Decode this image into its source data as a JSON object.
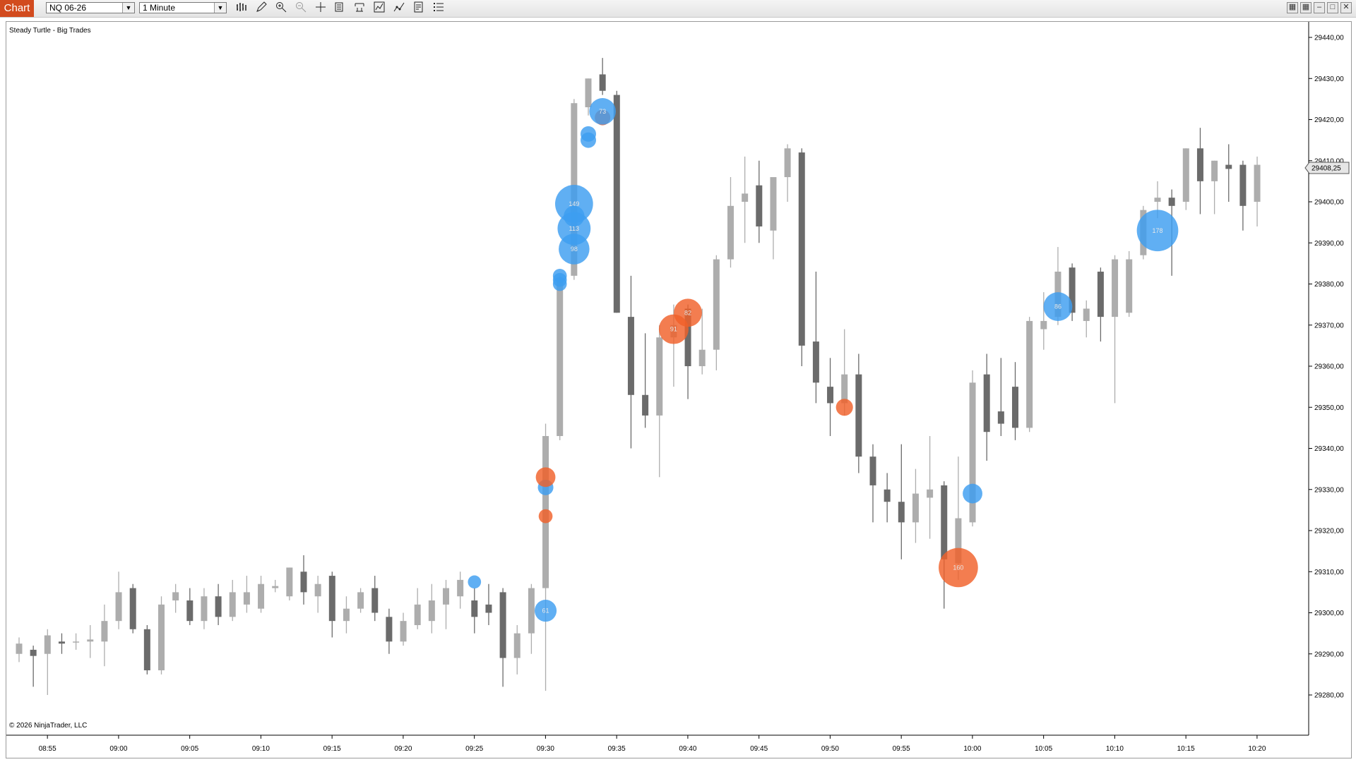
{
  "toolbar": {
    "tab_label": "Chart",
    "instrument": "NQ 06-26",
    "interval": "1 Minute",
    "icons": [
      "bar-type-icon",
      "pencil-icon",
      "zoom-in-icon",
      "zoom-out-icon",
      "crosshair-icon",
      "data-box-icon",
      "properties-icon",
      "strategies-icon",
      "indicators-icon",
      "templates-icon",
      "list-icon"
    ],
    "window_buttons": [
      "tile-icon",
      "snap-icon",
      "minimize-icon",
      "maximize-icon",
      "close-icon"
    ]
  },
  "chart": {
    "indicator_label": "Steady Turtle - Big Trades",
    "copyright": "© 2026 NinjaTrader, LLC",
    "current_price_label": "29408,25",
    "colors": {
      "up": "#adadad",
      "down": "#6b6b6b",
      "buy": "#3d9df0",
      "sell": "#f0602a",
      "price_tag_bg": "#e6e6e6"
    }
  },
  "chart_data": {
    "type": "candlestick",
    "x_tick_labels": [
      "08:55",
      "09:00",
      "09:05",
      "09:10",
      "09:15",
      "09:20",
      "09:25",
      "09:30",
      "09:35",
      "09:40",
      "09:45",
      "09:50",
      "09:55",
      "10:00",
      "10:05",
      "10:10",
      "10:15",
      "10:20"
    ],
    "y_tick_labels": [
      "29440,00",
      "29430,00",
      "29420,00",
      "29410,00",
      "29400,00",
      "29390,00",
      "29380,00",
      "29370,00",
      "29360,00",
      "29350,00",
      "29340,00",
      "29330,00",
      "29320,00",
      "29310,00",
      "29300,00",
      "29290,00",
      "29280,00"
    ],
    "ylim": [
      29276,
      29444
    ],
    "start_time": "08:54",
    "candles": [
      {
        "o": 29290,
        "h": 29294,
        "l": 29288,
        "c": 29292.5
      },
      {
        "o": 29291,
        "h": 29292,
        "l": 29282,
        "c": 29289.5
      },
      {
        "o": 29290,
        "h": 29296,
        "l": 29280,
        "c": 29294.5
      },
      {
        "o": 29293,
        "h": 29295,
        "l": 29290,
        "c": 29292.5
      },
      {
        "o": 29293,
        "h": 29295,
        "l": 29291,
        "c": 29293
      },
      {
        "o": 29293,
        "h": 29297,
        "l": 29289,
        "c": 29293.5
      },
      {
        "o": 29293,
        "h": 29302,
        "l": 29287,
        "c": 29298
      },
      {
        "o": 29298,
        "h": 29310,
        "l": 29296,
        "c": 29305
      },
      {
        "o": 29306,
        "h": 29307,
        "l": 29295,
        "c": 29296
      },
      {
        "o": 29296,
        "h": 29297,
        "l": 29285,
        "c": 29286
      },
      {
        "o": 29286,
        "h": 29304,
        "l": 29285,
        "c": 29302
      },
      {
        "o": 29303,
        "h": 29307,
        "l": 29300,
        "c": 29305
      },
      {
        "o": 29303,
        "h": 29306,
        "l": 29297,
        "c": 29298
      },
      {
        "o": 29298,
        "h": 29306,
        "l": 29296,
        "c": 29304
      },
      {
        "o": 29304,
        "h": 29307,
        "l": 29297,
        "c": 29299
      },
      {
        "o": 29299,
        "h": 29308,
        "l": 29298,
        "c": 29305
      },
      {
        "o": 29302,
        "h": 29309,
        "l": 29300,
        "c": 29305
      },
      {
        "o": 29301,
        "h": 29309,
        "l": 29300,
        "c": 29307
      },
      {
        "o": 29306,
        "h": 29308,
        "l": 29305,
        "c": 29306.5
      },
      {
        "o": 29304,
        "h": 29311,
        "l": 29303,
        "c": 29311
      },
      {
        "o": 29310,
        "h": 29314,
        "l": 29302,
        "c": 29305
      },
      {
        "o": 29304,
        "h": 29309,
        "l": 29300,
        "c": 29307
      },
      {
        "o": 29309,
        "h": 29310,
        "l": 29294,
        "c": 29298
      },
      {
        "o": 29298,
        "h": 29304,
        "l": 29295,
        "c": 29301
      },
      {
        "o": 29301,
        "h": 29306,
        "l": 29300,
        "c": 29305
      },
      {
        "o": 29306,
        "h": 29309,
        "l": 29298,
        "c": 29300
      },
      {
        "o": 29299,
        "h": 29301,
        "l": 29290,
        "c": 29293
      },
      {
        "o": 29293,
        "h": 29300,
        "l": 29292,
        "c": 29298
      },
      {
        "o": 29297,
        "h": 29306,
        "l": 29296,
        "c": 29302
      },
      {
        "o": 29298,
        "h": 29307,
        "l": 29295,
        "c": 29303
      },
      {
        "o": 29302,
        "h": 29308,
        "l": 29296,
        "c": 29306
      },
      {
        "o": 29304,
        "h": 29310,
        "l": 29301,
        "c": 29308
      },
      {
        "o": 29303,
        "h": 29306,
        "l": 29295,
        "c": 29299
      },
      {
        "o": 29302,
        "h": 29307,
        "l": 29297,
        "c": 29300
      },
      {
        "o": 29305,
        "h": 29306,
        "l": 29282,
        "c": 29289
      },
      {
        "o": 29289,
        "h": 29297,
        "l": 29285,
        "c": 29295
      },
      {
        "o": 29295,
        "h": 29307,
        "l": 29290,
        "c": 29306
      },
      {
        "o": 29306,
        "h": 29346,
        "l": 29281,
        "c": 29343
      },
      {
        "o": 29343,
        "h": 29382,
        "l": 29342,
        "c": 29381
      },
      {
        "o": 29382,
        "h": 29425,
        "l": 29381,
        "c": 29424
      },
      {
        "o": 29423,
        "h": 29430,
        "l": 29421,
        "c": 29430
      },
      {
        "o": 29431,
        "h": 29435,
        "l": 29426,
        "c": 29427
      },
      {
        "o": 29426,
        "h": 29427,
        "l": 29373,
        "c": 29373
      },
      {
        "o": 29372,
        "h": 29382,
        "l": 29340,
        "c": 29353
      },
      {
        "o": 29353,
        "h": 29368,
        "l": 29345,
        "c": 29348
      },
      {
        "o": 29348,
        "h": 29370,
        "l": 29333,
        "c": 29367
      },
      {
        "o": 29367,
        "h": 29375,
        "l": 29355,
        "c": 29370
      },
      {
        "o": 29374,
        "h": 29375,
        "l": 29352,
        "c": 29360
      },
      {
        "o": 29360,
        "h": 29374,
        "l": 29358,
        "c": 29364
      },
      {
        "o": 29364,
        "h": 29387,
        "l": 29359,
        "c": 29386
      },
      {
        "o": 29386,
        "h": 29406,
        "l": 29384,
        "c": 29399
      },
      {
        "o": 29400,
        "h": 29411,
        "l": 29390,
        "c": 29402
      },
      {
        "o": 29404,
        "h": 29410,
        "l": 29390,
        "c": 29394
      },
      {
        "o": 29393,
        "h": 29405,
        "l": 29386,
        "c": 29406
      },
      {
        "o": 29406,
        "h": 29414,
        "l": 29400,
        "c": 29413
      },
      {
        "o": 29412,
        "h": 29413,
        "l": 29360,
        "c": 29365
      },
      {
        "o": 29366,
        "h": 29383,
        "l": 29351,
        "c": 29356
      },
      {
        "o": 29355,
        "h": 29362,
        "l": 29343,
        "c": 29351
      },
      {
        "o": 29351,
        "h": 29369,
        "l": 29348,
        "c": 29358
      },
      {
        "o": 29358,
        "h": 29363,
        "l": 29334,
        "c": 29338
      },
      {
        "o": 29338,
        "h": 29341,
        "l": 29322,
        "c": 29331
      },
      {
        "o": 29330,
        "h": 29334,
        "l": 29322,
        "c": 29327
      },
      {
        "o": 29327,
        "h": 29341,
        "l": 29313,
        "c": 29322
      },
      {
        "o": 29322,
        "h": 29335,
        "l": 29317,
        "c": 29329
      },
      {
        "o": 29328,
        "h": 29343,
        "l": 29318,
        "c": 29330
      },
      {
        "o": 29331,
        "h": 29332,
        "l": 29301,
        "c": 29313
      },
      {
        "o": 29312,
        "h": 29338,
        "l": 29308,
        "c": 29323
      },
      {
        "o": 29322,
        "h": 29359,
        "l": 29321,
        "c": 29356
      },
      {
        "o": 29358,
        "h": 29363,
        "l": 29337,
        "c": 29344
      },
      {
        "o": 29349,
        "h": 29362,
        "l": 29343,
        "c": 29346
      },
      {
        "o": 29355,
        "h": 29361,
        "l": 29342,
        "c": 29345
      },
      {
        "o": 29345,
        "h": 29372,
        "l": 29344,
        "c": 29371
      },
      {
        "o": 29369,
        "h": 29378,
        "l": 29364,
        "c": 29371
      },
      {
        "o": 29372,
        "h": 29389,
        "l": 29370,
        "c": 29383
      },
      {
        "o": 29384,
        "h": 29385,
        "l": 29371,
        "c": 29373
      },
      {
        "o": 29371,
        "h": 29376,
        "l": 29367,
        "c": 29374
      },
      {
        "o": 29383,
        "h": 29384,
        "l": 29366,
        "c": 29372
      },
      {
        "o": 29372,
        "h": 29387,
        "l": 29351,
        "c": 29386
      },
      {
        "o": 29373,
        "h": 29388,
        "l": 29372,
        "c": 29386
      },
      {
        "o": 29387,
        "h": 29399,
        "l": 29386,
        "c": 29398
      },
      {
        "o": 29400,
        "h": 29405,
        "l": 29396,
        "c": 29401
      },
      {
        "o": 29401,
        "h": 29403,
        "l": 29382,
        "c": 29399
      },
      {
        "o": 29400,
        "h": 29413,
        "l": 29398,
        "c": 29413
      },
      {
        "o": 29413,
        "h": 29418,
        "l": 29397,
        "c": 29405
      },
      {
        "o": 29405,
        "h": 29410,
        "l": 29397,
        "c": 29410
      },
      {
        "o": 29409,
        "h": 29414,
        "l": 29400,
        "c": 29408
      },
      {
        "o": 29409,
        "h": 29410,
        "l": 29393,
        "c": 29399
      },
      {
        "o": 29400,
        "h": 29411,
        "l": 29394,
        "c": 29409
      }
    ],
    "big_trades": [
      {
        "t": "09:26",
        "p": 29307.5,
        "side": "buy",
        "size": 18,
        "label": ""
      },
      {
        "t": "09:31",
        "p": 29300.5,
        "side": "buy",
        "size": 50,
        "label": "61"
      },
      {
        "t": "09:31",
        "p": 29323.5,
        "side": "sell",
        "size": 20,
        "label": ""
      },
      {
        "t": "09:31",
        "p": 29330.5,
        "side": "buy",
        "size": 25,
        "label": ""
      },
      {
        "t": "09:31",
        "p": 29333,
        "side": "sell",
        "size": 40,
        "label": ""
      },
      {
        "t": "09:32",
        "p": 29380,
        "side": "buy",
        "size": 20,
        "label": ""
      },
      {
        "t": "09:32",
        "p": 29381,
        "side": "buy",
        "size": 20,
        "label": ""
      },
      {
        "t": "09:32",
        "p": 29382,
        "side": "buy",
        "size": 20,
        "label": ""
      },
      {
        "t": "09:33",
        "p": 29388.5,
        "side": "buy",
        "size": 98,
        "label": "98"
      },
      {
        "t": "09:33",
        "p": 29393.5,
        "side": "buy",
        "size": 113,
        "label": "113"
      },
      {
        "t": "09:33",
        "p": 29396.5,
        "side": "buy",
        "size": 45,
        "label": ""
      },
      {
        "t": "09:33",
        "p": 29399.5,
        "side": "buy",
        "size": 149,
        "label": "149"
      },
      {
        "t": "09:34",
        "p": 29415,
        "side": "buy",
        "size": 25,
        "label": ""
      },
      {
        "t": "09:34",
        "p": 29416.5,
        "side": "buy",
        "size": 25,
        "label": ""
      },
      {
        "t": "09:35",
        "p": 29420.5,
        "side": "sell",
        "size": 25,
        "label": ""
      },
      {
        "t": "09:35",
        "p": 29422,
        "side": "buy",
        "size": 73,
        "label": "73"
      },
      {
        "t": "09:40",
        "p": 29369,
        "side": "sell",
        "size": 91,
        "label": "91"
      },
      {
        "t": "09:41",
        "p": 29373,
        "side": "sell",
        "size": 82,
        "label": "82"
      },
      {
        "t": "09:52",
        "p": 29350,
        "side": "sell",
        "size": 30,
        "label": ""
      },
      {
        "t": "10:00",
        "p": 29311,
        "side": "sell",
        "size": 160,
        "label": "160"
      },
      {
        "t": "10:01",
        "p": 29329,
        "side": "buy",
        "size": 40,
        "label": ""
      },
      {
        "t": "10:07",
        "p": 29374.5,
        "side": "buy",
        "size": 86,
        "label": "86"
      },
      {
        "t": "10:14",
        "p": 29393,
        "side": "buy",
        "size": 178,
        "label": "178"
      }
    ]
  }
}
